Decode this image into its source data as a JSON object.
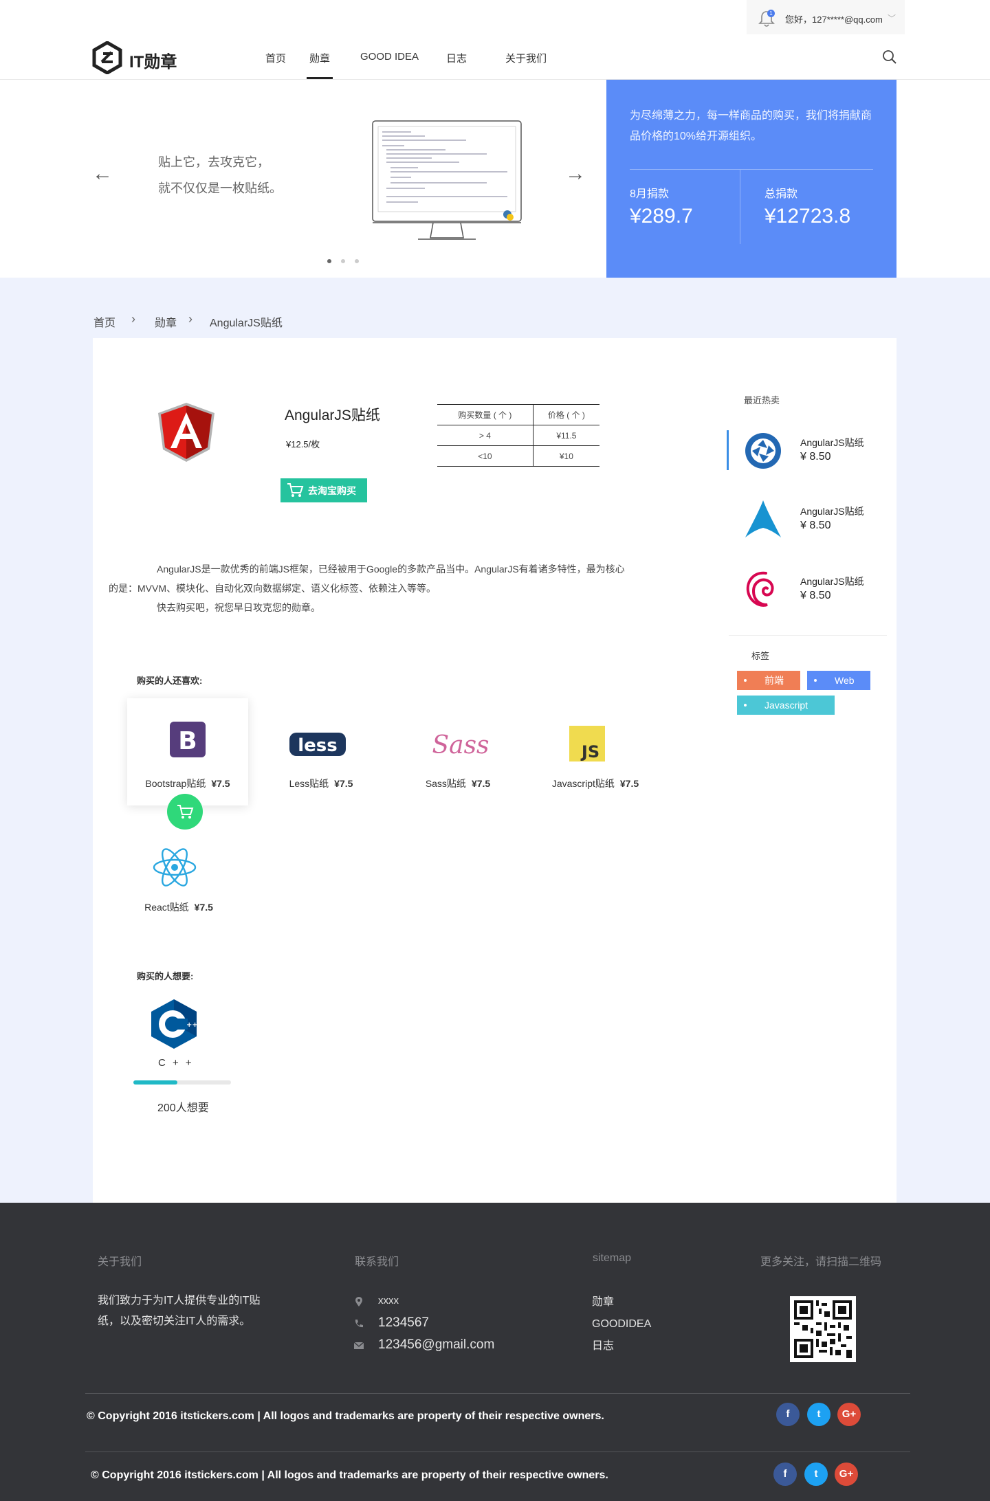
{
  "header": {
    "greeting": "您好，127*****@qq.com",
    "notification_count": "1",
    "logo_text": "IT勋章",
    "nav": [
      "首页",
      "勋章",
      "GOOD IDEA",
      "日志",
      "关于我们"
    ],
    "active_nav": "勋章"
  },
  "hero": {
    "line1": "贴上它，去攻克它，",
    "line2": "就不仅仅是一枚贴纸。",
    "slide_count": 3,
    "active_slide": 1
  },
  "donation": {
    "text": "为尽绵薄之力，每一样商品的购买，我们将捐献商品价格的10%给开源组织。",
    "month_label": "8月捐款",
    "month_value": "¥289.7",
    "total_label": "总捐款",
    "total_value": "¥12723.8"
  },
  "breadcrumb": [
    "首页",
    "勋章",
    "AngularJS贴纸"
  ],
  "product": {
    "title": "AngularJS贴纸",
    "price": "¥12.5/枚",
    "buy_button": "去淘宝购买",
    "table_headers": [
      "购买数量 ( 个 )",
      "价格 ( 个 )"
    ],
    "table_rows": [
      [
        "> 4",
        "¥11.5"
      ],
      [
        "<10",
        "¥10"
      ]
    ],
    "description": [
      "AngularJS是一款优秀的前端JS框架，已经被用于Google的多款产品当中。AngularJS有着诸多特性，最为核心",
      "的是：MVVM、模块化、自动化双向数据绑定、语义化标签、依赖注入等等。",
      "快去购买吧，祝您早日攻克您的勋章。"
    ]
  },
  "also_liked": {
    "title": "购买的人还喜欢:",
    "items": [
      {
        "name": "Bootstrap贴纸",
        "price": "¥7.5",
        "icon": "bootstrap-icon"
      },
      {
        "name": "Less贴纸",
        "price": "¥7.5",
        "icon": "less-icon"
      },
      {
        "name": "Sass贴纸",
        "price": "¥7.5",
        "icon": "sass-icon"
      },
      {
        "name": "Javascript贴纸",
        "price": "¥7.5",
        "icon": "javascript-icon"
      },
      {
        "name": "React贴纸",
        "price": "¥7.5",
        "icon": "react-icon"
      }
    ]
  },
  "wanted": {
    "title": "购买的人想要:",
    "item_name": "C + +",
    "progress": 0.45,
    "count_label": "200人想要"
  },
  "sidebar": {
    "hot_title": "最近热卖",
    "hot_items": [
      {
        "name": "AngularJS贴纸",
        "price": "¥ 8.50",
        "icon": "shutter-icon"
      },
      {
        "name": "AngularJS贴纸",
        "price": "¥ 8.50",
        "icon": "arch-icon"
      },
      {
        "name": "AngularJS贴纸",
        "price": "¥ 8.50",
        "icon": "debian-icon"
      }
    ],
    "tags_title": "标签",
    "tags": [
      {
        "label": "前端",
        "color": "#f07e55"
      },
      {
        "label": "Web",
        "color": "#5b8cf8"
      },
      {
        "label": "Javascript",
        "color": "#4cc7d6"
      }
    ]
  },
  "footer": {
    "about_title": "关于我们",
    "about_text": [
      "我们致力于为IT人提供专业的IT贴",
      "纸，以及密切关注IT人的需求。"
    ],
    "contact_title": "联系我们",
    "address": "xxxx",
    "phone": "1234567",
    "email": "123456@gmail.com",
    "sitemap_title": "sitemap",
    "sitemap_links": [
      "勋章",
      "GOODIDEA",
      "日志"
    ],
    "qr_title": "更多关注，请扫描二维码",
    "copyright": "© Copyright 2016 itstickers.com | All logos and trademarks are property of their respective owners.",
    "social": [
      {
        "label": "f",
        "color": "#3b5998"
      },
      {
        "label": "t",
        "color": "#1da1f2"
      },
      {
        "label": "G+",
        "color": "#dd4b39"
      }
    ]
  }
}
